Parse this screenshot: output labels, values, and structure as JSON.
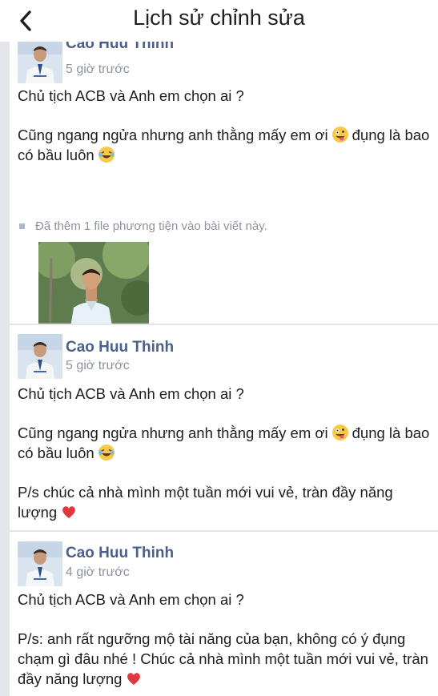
{
  "header": {
    "title": "Lịch sử chỉnh sửa",
    "back_icon": "chevron-left-icon"
  },
  "entries": [
    {
      "author": "Cao Huu Thinh",
      "time": "5 giờ trước",
      "line1": "Chủ tịch ACB và Anh em chọn ai ?",
      "para2_a": "Cũng ngang ngửa nhưng anh thằng mấy em ơi",
      "para2_b": "đụng là bao có bầu luôn",
      "media_note": "Đã thêm 1 file phương tiện vào bài viết này."
    },
    {
      "author": "Cao Huu Thinh",
      "time": "5 giờ trước",
      "line1": "Chủ tịch ACB và Anh em chọn ai ?",
      "para2_a": "Cũng ngang ngửa nhưng anh thằng mấy em ơi",
      "para2_b": "đụng là bao có bầu luôn",
      "para3": "P/s chúc cả nhà mình một tuần mới vui vẻ, tràn đầy năng lượng"
    },
    {
      "author": "Cao Huu Thinh",
      "time": "4 giờ trước",
      "line1": "Chủ tịch ACB và Anh em chọn ai ?",
      "para2": "P/s: anh rất ngưỡng mộ tài năng của bạn, không có ý đụng chạm gì đâu nhé ! Chúc cả nhà mình một tuần mới vui vẻ, tràn đầy năng lượng"
    }
  ],
  "colors": {
    "author": "#4b5f8a",
    "meta": "#8d949e",
    "divider": "#e4e6eb"
  }
}
